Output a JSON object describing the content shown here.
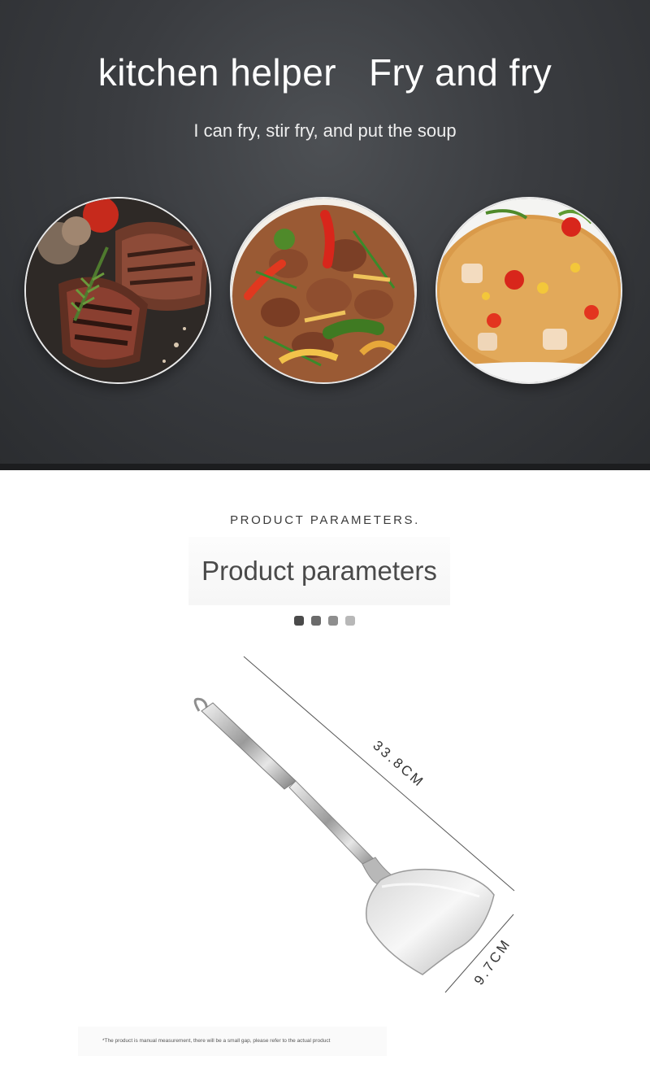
{
  "hero": {
    "title": "kitchen helper   Fry and fry",
    "subtitle": "I can fry, stir fry, and put the soup",
    "dishes": [
      {
        "name": "grilled-steak"
      },
      {
        "name": "stir-fried-beef-peppers"
      },
      {
        "name": "fried-rice"
      }
    ]
  },
  "params": {
    "kicker": "PRODUCT PARAMETERS.",
    "title": "Product parameters",
    "dot_colors": [
      "#4a4a4a",
      "#6b6b6b",
      "#8e8e8e",
      "#b8b8b8"
    ]
  },
  "product": {
    "length_label": "33.8CM",
    "width_label": "9.7CM",
    "note": "*The product is manual measurement, there will be a small gap, please refer to the actual product"
  }
}
